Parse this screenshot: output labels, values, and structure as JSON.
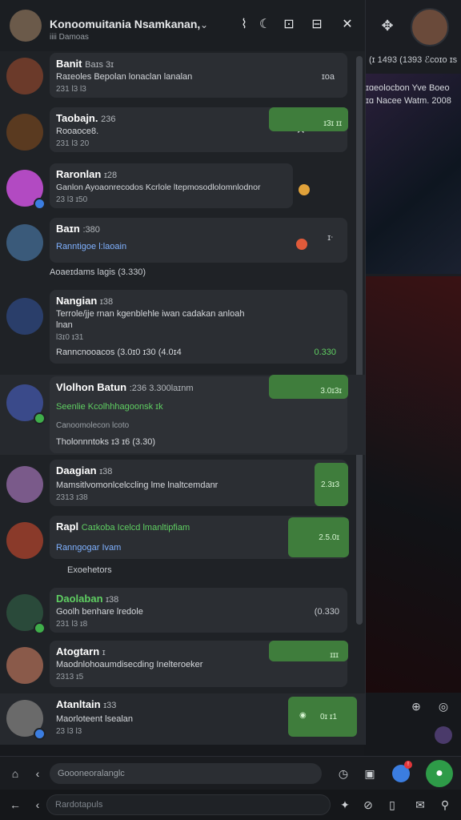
{
  "header": {
    "title": "Konoomuitania Nsamkanan,",
    "subtitle": "iiii  Damoas",
    "chev_icon": "chevron-down-icon",
    "buttons": [
      "⌇",
      "☾",
      "⊡",
      "⊟",
      "✕"
    ]
  },
  "bg": {
    "line1": "(ɪ 1493  (1393  ℰcoɪo ɪs",
    "news1": "ɪɑeolocbon  Yve  Boeo",
    "news2": "ɪɑ Nacee Watm. 2008"
  },
  "rows": [
    {
      "name": "Banit",
      "time": "Baɪs 3ɪ",
      "msg": "Raɪeoles  Bepolan lonaclan lanalan",
      "sub": "231 l3 l3",
      "right": "ɪoa"
    },
    {
      "name": "Taobajn.",
      "time": "236",
      "msg": "Rooaoce8.",
      "sub": "231 l3 20",
      "right": "ɪ3ɪ ɪɪ",
      "right_icon": "✕"
    },
    {
      "name": "Raronlan",
      "time": "ɪ28",
      "msg": "Ganlon Ayoaonrecodos Kcrlole ltepmosodlolomnlodnor",
      "sub": "23 l3 ɪ50",
      "right": ""
    },
    {
      "name": "Baɪn",
      "time": ":380",
      "msg": "Ranntigoe  l:laoain",
      "sub": "",
      "right": "ɪᐧ"
    },
    {
      "name": "Nangian",
      "time": "ɪ38",
      "msg": "Terrole/jje  rnan  kgenblehle  iwan  cadakan anloah",
      "msg2": "lnan",
      "sub": "l3ɪ0 ɪ31",
      "extra": "Ranncnooacos  (3.0ɪ0  ɪ30  (4.0ɪ4",
      "right": "0.330"
    },
    {
      "name": "Vlolhon Batun",
      "time": ":236 3.300laɪnm",
      "msg": "Seenlie  Kcolhhhagoonsk  ɪk",
      "sub": "Canoomolecon lcoto",
      "extra": "Tholonnntoks  ɪ3  ɪ6  (3.30)",
      "right": "3.0ɪ3ɪ"
    },
    {
      "name": "Daagian",
      "time": "ɪ38",
      "msg": "Mamsitlvomonlcelccling  lme  lnaltcemdanr",
      "sub": "2313 ɪ38",
      "right": "2.3ɪ3"
    },
    {
      "name": "Rapl",
      "time": "Caɪkoba  Icelcd  lmanltipfiam",
      "msg": "Ranngogar  Ivam",
      "sub": "",
      "right": "2.5.0ɪ"
    },
    {
      "name": "Daolaban",
      "time": "ɪ38",
      "msg": "Goolh benhare  lredole",
      "sub": "231 l3 ɪ8",
      "right": "(0.330"
    },
    {
      "name": "Atogtarn",
      "time": "ɪ",
      "msg": "Maodnlohoaumdisecding  Inelteroeker",
      "sub": "2313 ɪ5",
      "right": "ɪɪɪ"
    },
    {
      "name": "Atanltain",
      "time": "ɪ33",
      "msg": "Maorloteent  lsealan",
      "sub": "23 l3 l3",
      "right": "0ɪ  ɪ1"
    }
  ],
  "extras": {
    "row4_extra": "Aoaeɪdams  lagis  (3.330)",
    "row8_extra": "Exoehetors"
  },
  "footer": {
    "input_placeholder": "Goooneoralanglc",
    "input2_placeholder": "Rardotapuls"
  },
  "colors": {
    "accent": "#3f7d3c",
    "bg": "#1f2226",
    "bubble": "#2b2e33"
  }
}
